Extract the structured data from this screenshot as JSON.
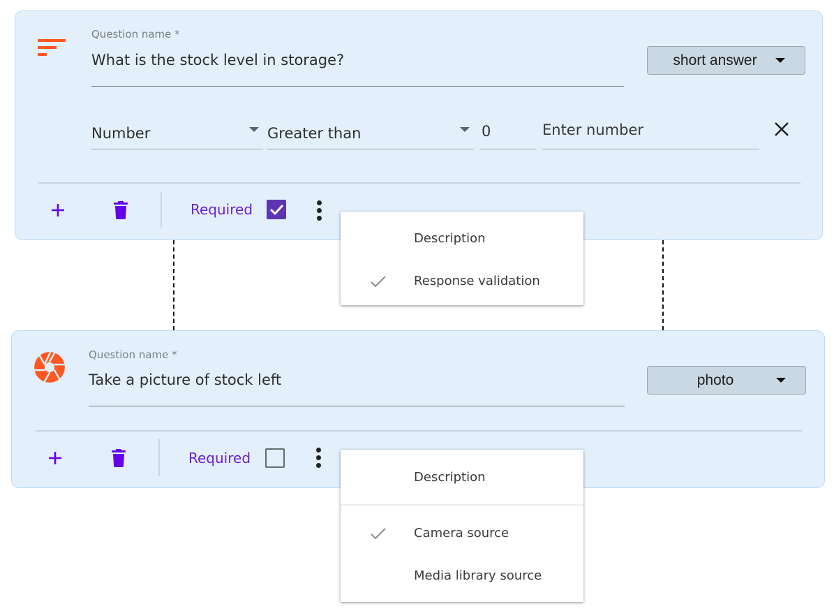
{
  "questions": [
    {
      "type_icon": "short-answer-icon",
      "label": "Question name *",
      "value": "What is the stock level in storage?",
      "type_select": "short answer",
      "validation": {
        "kind": "Number",
        "operator": "Greater than",
        "value": "0",
        "placeholder": "Enter number",
        "close_icon": "close-icon"
      },
      "footer": {
        "add_icon": "plus-icon",
        "delete_icon": "trash-icon",
        "required_label": "Required",
        "required_checked": true,
        "more_icon": "more-vertical-icon"
      },
      "menu": {
        "items": [
          {
            "label": "Description",
            "checked": false
          },
          {
            "label": "Response validation",
            "checked": true
          }
        ]
      }
    },
    {
      "type_icon": "camera-shutter-icon",
      "label": "Question name *",
      "value": "Take a picture of stock left",
      "type_select": "photo",
      "footer": {
        "add_icon": "plus-icon",
        "delete_icon": "trash-icon",
        "required_label": "Required",
        "required_checked": false,
        "more_icon": "more-vertical-icon"
      },
      "menu": {
        "items": [
          {
            "label": "Description",
            "checked": false
          },
          {
            "label": "Camera source",
            "checked": true
          },
          {
            "label": "Media library source",
            "checked": false
          }
        ]
      }
    }
  ],
  "colors": {
    "accent_orange": "#ff5722",
    "accent_purple": "#6200ea",
    "checkbox_purple": "#5e35b1",
    "card_bg": "#e3f0fc"
  }
}
